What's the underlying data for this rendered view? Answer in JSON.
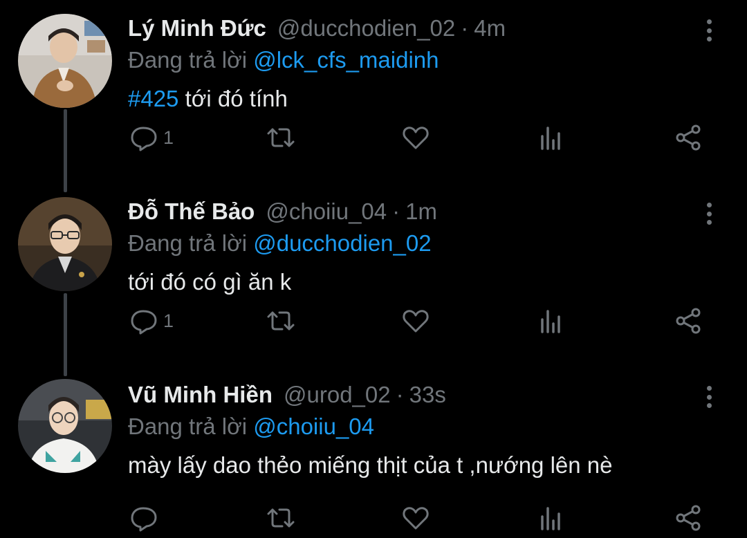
{
  "colors": {
    "background": "#000000",
    "text_primary": "#e7e9ea",
    "text_secondary": "#71767b",
    "accent": "#1d9bf0",
    "thread_line": "#3d4248"
  },
  "tweets": [
    {
      "display_name": "Lý Minh Đức",
      "handle": "@ducchodien_02",
      "separator": "·",
      "time": "4m",
      "reply_prefix": "Đang trả lời",
      "reply_to": "@lck_cfs_maidinh",
      "hashtag": "#425",
      "text": " tới đó tính",
      "reply_count": "1",
      "retweet_count": "",
      "like_count": "",
      "icons": [
        "reply-icon",
        "retweet-icon",
        "like-icon",
        "views-icon",
        "share-icon",
        "more-icon"
      ]
    },
    {
      "display_name": "Đỗ Thế Bảo",
      "handle": "@choiiu_04",
      "separator": "·",
      "time": "1m",
      "reply_prefix": "Đang trả lời",
      "reply_to": "@ducchodien_02",
      "hashtag": "",
      "text": "tới đó có gì ăn k",
      "reply_count": "1",
      "retweet_count": "",
      "like_count": "",
      "icons": [
        "reply-icon",
        "retweet-icon",
        "like-icon",
        "views-icon",
        "share-icon",
        "more-icon"
      ]
    },
    {
      "display_name": "Vũ Minh Hiền",
      "handle": "@urod_02",
      "separator": "·",
      "time": "33s",
      "reply_prefix": "Đang trả lời",
      "reply_to": "@choiiu_04",
      "hashtag": "",
      "text": "mày lấy dao thẻo miếng thịt của t ,nướng lên nè",
      "reply_count": "",
      "retweet_count": "",
      "like_count": "",
      "icons": [
        "reply-icon",
        "retweet-icon",
        "like-icon",
        "views-icon",
        "share-icon",
        "more-icon"
      ]
    }
  ]
}
